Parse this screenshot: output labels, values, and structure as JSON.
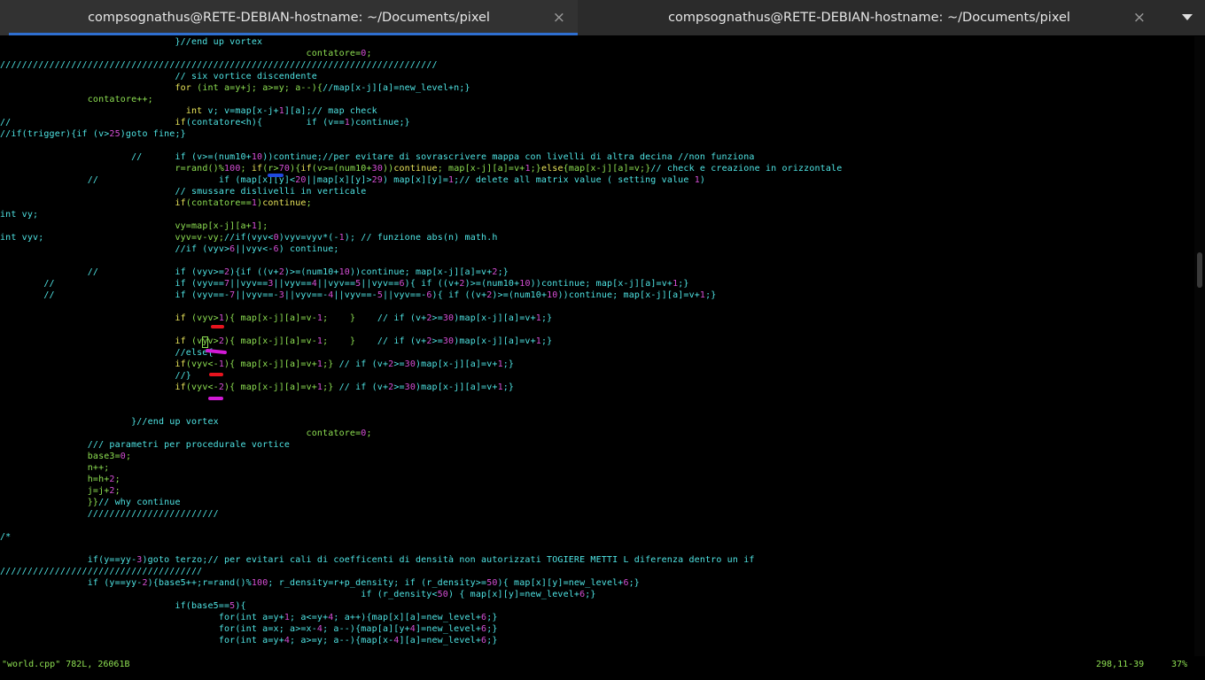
{
  "tabs": [
    {
      "title": "compsognathus@RETE-DEBIAN-hostname: ~/Documents/pixel",
      "close_glyph": "×",
      "active": true
    },
    {
      "title": "compsognathus@RETE-DEBIAN-hostname: ~/Documents/pixel",
      "close_glyph": "×",
      "active": false
    }
  ],
  "tab_menu_icon": "chevron-down-icon",
  "colors": {
    "comment": "#4fe4e4",
    "code": "#8ee052",
    "keyword": "#e8e45a",
    "number": "#d64fd6",
    "annotation_red": "#e8141e",
    "annotation_magenta": "#d21ad6",
    "annotation_blue": "#1f49e0",
    "tab_accent": "#2f6fd0"
  },
  "editor_lines": [
    [
      [
        "                                }//end up vortex",
        "t"
      ]
    ],
    [
      [
        "                                                        contatore=",
        "g"
      ],
      [
        "0",
        "m"
      ],
      [
        ";",
        "g"
      ]
    ],
    [
      [
        "////////////////////////////////////////////////////////////////////////////////",
        "t"
      ]
    ],
    [
      [
        "                                // six vortice discendente",
        "t"
      ]
    ],
    [
      [
        "                                ",
        "t"
      ],
      [
        "for",
        "y"
      ],
      [
        " (",
        "g"
      ],
      [
        "int",
        "g"
      ],
      [
        " a=y+j; a>=y; a--){",
        "g"
      ],
      [
        "//map[x-j][a]=new_level+n;}",
        "t"
      ]
    ],
    [
      [
        "                ",
        "g"
      ],
      [
        "contatore++;",
        "g"
      ]
    ],
    [
      [
        "                                  ",
        "g"
      ],
      [
        "int",
        "y"
      ],
      [
        " v; v=map[x-j+",
        "t"
      ],
      [
        "1",
        "m"
      ],
      [
        "][a];// map check",
        "t"
      ]
    ],
    [
      [
        "//                              ",
        "t"
      ],
      [
        "if",
        "y"
      ],
      [
        "(contatore<h){        if (v==",
        "t"
      ],
      [
        "1",
        "m"
      ],
      [
        ")continue;}",
        "t"
      ]
    ],
    [
      [
        "//if(trigger){if (v>",
        "t"
      ],
      [
        "25",
        "m"
      ],
      [
        ")goto fine;}",
        "t"
      ]
    ],
    [
      [
        "",
        "t"
      ]
    ],
    [
      [
        "                        //      if (v>=(num10+",
        "t"
      ],
      [
        "10",
        "m"
      ],
      [
        "))continue;//per evitare di sovrascrivere mappa con livelli di altra decina //non funziona",
        "t"
      ]
    ],
    [
      [
        "                                ",
        "g"
      ],
      [
        "r=rand()%",
        "g"
      ],
      [
        "100",
        "m"
      ],
      [
        "; ",
        "g"
      ],
      [
        "if",
        "y"
      ],
      [
        "(r>",
        "g"
      ],
      [
        "70",
        "m"
      ],
      [
        "){",
        "g"
      ],
      [
        "if",
        "y"
      ],
      [
        "(v>=(num10+",
        "g"
      ],
      [
        "30",
        "m"
      ],
      [
        "))",
        "g"
      ],
      [
        "continue",
        "y"
      ],
      [
        "; map[x-j][a]=v+",
        "g"
      ],
      [
        "1",
        "m"
      ],
      [
        ";}",
        "g"
      ],
      [
        "else",
        "y"
      ],
      [
        "{map[x-j][a]=v;}",
        "g"
      ],
      [
        "// check e creazione in orizzontale",
        "t"
      ]
    ],
    [
      [
        "                //                      if (map[x][y]<",
        "t"
      ],
      [
        "20",
        "m"
      ],
      [
        "||map[x][y]>",
        "t"
      ],
      [
        "29",
        "m"
      ],
      [
        ") map[x][y]=",
        "t"
      ],
      [
        "1",
        "m"
      ],
      [
        ";// delete all matrix value ( setting value ",
        "t"
      ],
      [
        "1",
        "m"
      ],
      [
        ")",
        "t"
      ]
    ],
    [
      [
        "                                // smussare dislivelli in verticale",
        "t"
      ]
    ],
    [
      [
        "                                ",
        "g"
      ],
      [
        "if",
        "y"
      ],
      [
        "(contatore==",
        "g"
      ],
      [
        "1",
        "m"
      ],
      [
        ")",
        "g"
      ],
      [
        "continue",
        "y"
      ],
      [
        ";",
        "g"
      ]
    ],
    [
      [
        "int vy;",
        "t"
      ]
    ],
    [
      [
        "                                ",
        "g"
      ],
      [
        "vy=map[x-j][a+",
        "g"
      ],
      [
        "1",
        "m"
      ],
      [
        "];",
        "g"
      ]
    ],
    [
      [
        "int vyv;                        ",
        "t"
      ],
      [
        "vyv=v-vy;",
        "g"
      ],
      [
        "//if(vyv<",
        "t"
      ],
      [
        "0",
        "m"
      ],
      [
        ")vyv=vyv*(-",
        "t"
      ],
      [
        "1",
        "m"
      ],
      [
        "); // funzione abs(n) math.h",
        "t"
      ]
    ],
    [
      [
        "                                //if (vyv>",
        "t"
      ],
      [
        "6",
        "m"
      ],
      [
        "||vyv<-",
        "t"
      ],
      [
        "6",
        "m"
      ],
      [
        ") continue;",
        "t"
      ]
    ],
    [
      [
        "",
        "t"
      ]
    ],
    [
      [
        "                //              if (vyv>=",
        "t"
      ],
      [
        "2",
        "m"
      ],
      [
        "){if ((v+",
        "t"
      ],
      [
        "2",
        "m"
      ],
      [
        ")>=(num10+",
        "t"
      ],
      [
        "10",
        "m"
      ],
      [
        "))continue; map[x-j][a]=v+",
        "t"
      ],
      [
        "2",
        "m"
      ],
      [
        ";}",
        "t"
      ]
    ],
    [
      [
        "        //                      if (vyv==",
        "t"
      ],
      [
        "7",
        "m"
      ],
      [
        "||vyv==",
        "t"
      ],
      [
        "3",
        "m"
      ],
      [
        "||vyv==",
        "t"
      ],
      [
        "4",
        "m"
      ],
      [
        "||vyv==",
        "t"
      ],
      [
        "5",
        "m"
      ],
      [
        "||vyv==",
        "t"
      ],
      [
        "6",
        "m"
      ],
      [
        "){ if ((v+",
        "t"
      ],
      [
        "2",
        "m"
      ],
      [
        ")>=(num10+",
        "t"
      ],
      [
        "10",
        "m"
      ],
      [
        "))continue; map[x-j][a]=v+",
        "t"
      ],
      [
        "1",
        "m"
      ],
      [
        ";}",
        "t"
      ]
    ],
    [
      [
        "        //                      if (vyv==-",
        "t"
      ],
      [
        "7",
        "m"
      ],
      [
        "||vyv==-",
        "t"
      ],
      [
        "3",
        "m"
      ],
      [
        "||vyv==-",
        "t"
      ],
      [
        "4",
        "m"
      ],
      [
        "||vyv==-",
        "t"
      ],
      [
        "5",
        "m"
      ],
      [
        "||vyv==-",
        "t"
      ],
      [
        "6",
        "m"
      ],
      [
        "){ if ((v+",
        "t"
      ],
      [
        "2",
        "m"
      ],
      [
        ")>=(num10+",
        "t"
      ],
      [
        "10",
        "m"
      ],
      [
        "))continue; map[x-j][a]=v+",
        "t"
      ],
      [
        "1",
        "m"
      ],
      [
        ";}",
        "t"
      ]
    ],
    [
      [
        "",
        "t"
      ]
    ],
    [
      [
        "                                ",
        "g"
      ],
      [
        "if",
        "y"
      ],
      [
        " (vyv>",
        "g"
      ],
      [
        "1",
        "m"
      ],
      [
        "){ map[x-j][a]=v-",
        "g"
      ],
      [
        "1",
        "m"
      ],
      [
        ";    }    ",
        "g"
      ],
      [
        "// if (v+",
        "t"
      ],
      [
        "2",
        "m"
      ],
      [
        ">=",
        "t"
      ],
      [
        "30",
        "m"
      ],
      [
        ")map[x-j][a]=v+",
        "t"
      ],
      [
        "1",
        "m"
      ],
      [
        ";}",
        "t"
      ]
    ],
    [
      [
        "",
        "t"
      ]
    ],
    [
      [
        "                                ",
        "g"
      ],
      [
        "if",
        "y"
      ],
      [
        " (vyv>",
        "g"
      ],
      [
        "2",
        "m"
      ],
      [
        "){ map[x-j][a]=v-",
        "g"
      ],
      [
        "1",
        "m"
      ],
      [
        ";    }    ",
        "g"
      ],
      [
        "// if (v+",
        "t"
      ],
      [
        "2",
        "m"
      ],
      [
        ">=",
        "t"
      ],
      [
        "30",
        "m"
      ],
      [
        ")map[x-j][a]=v+",
        "t"
      ],
      [
        "1",
        "m"
      ],
      [
        ";}",
        "t"
      ]
    ],
    [
      [
        "                                //else{",
        "t"
      ]
    ],
    [
      [
        "                                ",
        "g"
      ],
      [
        "if",
        "y"
      ],
      [
        "(vyv<-",
        "g"
      ],
      [
        "1",
        "m"
      ],
      [
        "){ map[x-j][a]=v+",
        "g"
      ],
      [
        "1",
        "m"
      ],
      [
        ";} ",
        "g"
      ],
      [
        "// if (v+",
        "t"
      ],
      [
        "2",
        "m"
      ],
      [
        ">=",
        "t"
      ],
      [
        "30",
        "m"
      ],
      [
        ")map[x-j][a]=v+",
        "t"
      ],
      [
        "1",
        "m"
      ],
      [
        ";}",
        "t"
      ]
    ],
    [
      [
        "                                //}",
        "t"
      ]
    ],
    [
      [
        "                                ",
        "g"
      ],
      [
        "if",
        "y"
      ],
      [
        "(vyv<-",
        "g"
      ],
      [
        "2",
        "m"
      ],
      [
        "){ map[x-j][a]=v+",
        "g"
      ],
      [
        "1",
        "m"
      ],
      [
        ";} ",
        "g"
      ],
      [
        "// if (v+",
        "t"
      ],
      [
        "2",
        "m"
      ],
      [
        ">=",
        "t"
      ],
      [
        "30",
        "m"
      ],
      [
        ")map[x-j][a]=v+",
        "t"
      ],
      [
        "1",
        "m"
      ],
      [
        ";}",
        "t"
      ]
    ],
    [
      [
        "",
        "t"
      ]
    ],
    [
      [
        "",
        "t"
      ]
    ],
    [
      [
        "                        }//end up vortex",
        "t"
      ]
    ],
    [
      [
        "                                                        contatore=",
        "g"
      ],
      [
        "0",
        "m"
      ],
      [
        ";",
        "g"
      ]
    ],
    [
      [
        "                /// parametri per procedurale vortice",
        "t"
      ]
    ],
    [
      [
        "                base3=",
        "g"
      ],
      [
        "0",
        "m"
      ],
      [
        ";",
        "g"
      ]
    ],
    [
      [
        "                n++;",
        "g"
      ]
    ],
    [
      [
        "                h=h+",
        "g"
      ],
      [
        "2",
        "m"
      ],
      [
        ";",
        "g"
      ]
    ],
    [
      [
        "                j=j+",
        "g"
      ],
      [
        "2",
        "m"
      ],
      [
        ";",
        "g"
      ]
    ],
    [
      [
        "                }}",
        "g"
      ],
      [
        "// why continue",
        "t"
      ]
    ],
    [
      [
        "                ////////////////////////",
        "t"
      ]
    ],
    [
      [
        "",
        "t"
      ]
    ],
    [
      [
        "/*",
        "t"
      ]
    ],
    [
      [
        "",
        "t"
      ]
    ],
    [
      [
        "                if(y==yy-",
        "t"
      ],
      [
        "3",
        "m"
      ],
      [
        ")goto terzo;// per evitari cali di coefficenti di densità non autorizzati TOGIERE METTI L diferenza dentro un if",
        "t"
      ]
    ],
    [
      [
        "/////////////////////////////////////",
        "t"
      ]
    ],
    [
      [
        "                if (y==yy-",
        "t"
      ],
      [
        "2",
        "m"
      ],
      [
        "){base5++;r=rand()%",
        "t"
      ],
      [
        "100",
        "m"
      ],
      [
        "; r_density=r+p_density; if (r_density>=",
        "t"
      ],
      [
        "50",
        "m"
      ],
      [
        "){ map[x][y]=new_level+",
        "t"
      ],
      [
        "6",
        "m"
      ],
      [
        ";}",
        "t"
      ]
    ],
    [
      [
        "                                                                  if (r_density<",
        "t"
      ],
      [
        "50",
        "m"
      ],
      [
        ") { map[x][y]=new_level+",
        "t"
      ],
      [
        "6",
        "m"
      ],
      [
        ";}",
        "t"
      ]
    ],
    [
      [
        "                                if(base5==",
        "t"
      ],
      [
        "5",
        "m"
      ],
      [
        "){",
        "t"
      ]
    ],
    [
      [
        "                                        for(int a=y+",
        "t"
      ],
      [
        "1",
        "m"
      ],
      [
        "; a<=y+",
        "t"
      ],
      [
        "4",
        "m"
      ],
      [
        "; a++){map[x][a]=new_level+",
        "t"
      ],
      [
        "6",
        "m"
      ],
      [
        ";}",
        "t"
      ]
    ],
    [
      [
        "                                        for(int a=x; a>=x-",
        "t"
      ],
      [
        "4",
        "m"
      ],
      [
        "; a--){map[a][y+",
        "t"
      ],
      [
        "4",
        "m"
      ],
      [
        "]=new_level+",
        "t"
      ],
      [
        "6",
        "m"
      ],
      [
        ";}",
        "t"
      ]
    ],
    [
      [
        "                                        for(int a=y+",
        "t"
      ],
      [
        "4",
        "m"
      ],
      [
        "; a>=y; a--){map[x-",
        "t"
      ],
      [
        "4",
        "m"
      ],
      [
        "][a]=new_level+",
        "t"
      ],
      [
        "6",
        "m"
      ],
      [
        ";}",
        "t"
      ]
    ]
  ],
  "status_bar": {
    "file_info": "\"world.cpp\" 782L, 26061B",
    "cursor_position": "298,11-39",
    "scroll_percent": "37%"
  },
  "scroll_fraction": 0.37
}
